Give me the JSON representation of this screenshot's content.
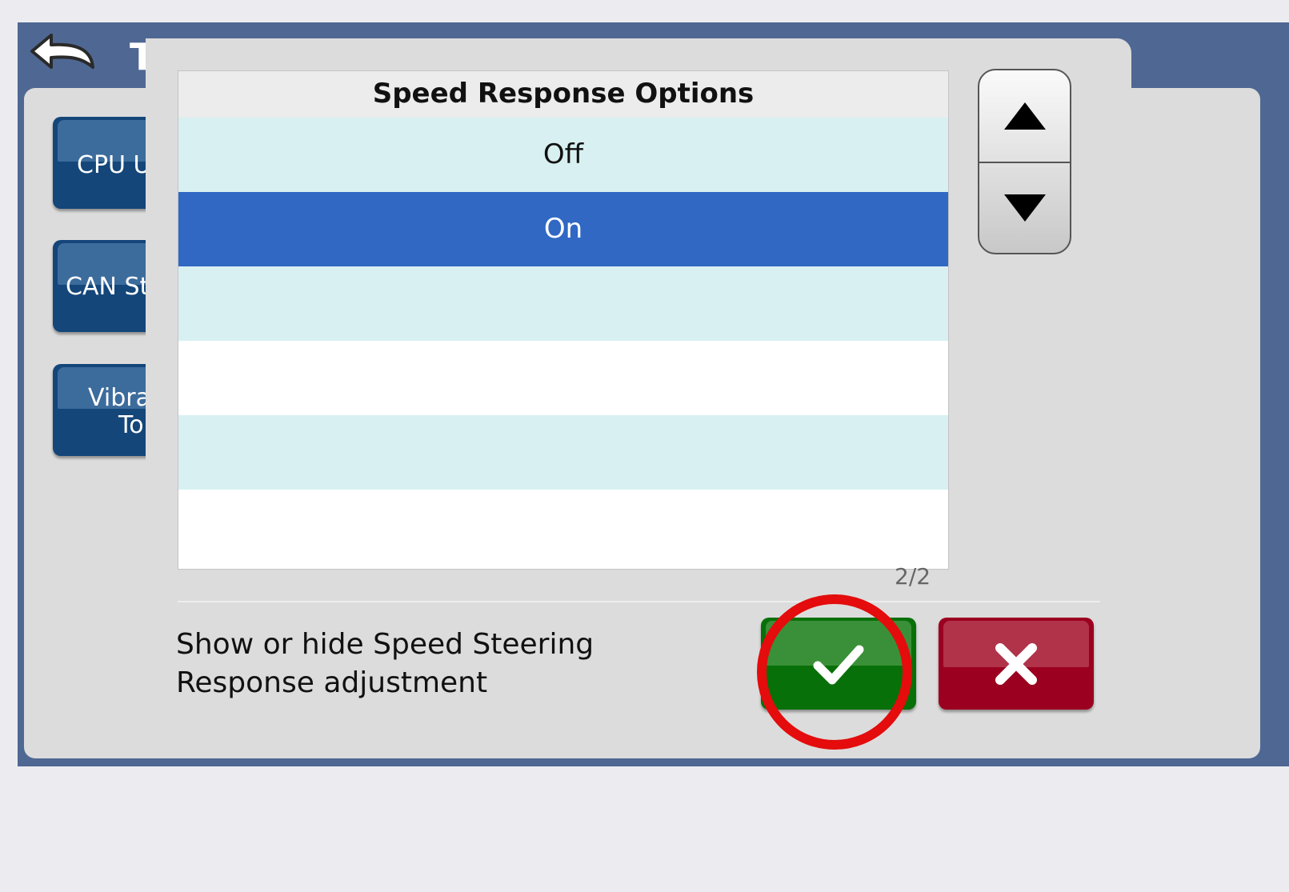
{
  "app": {
    "title": "T",
    "side_buttons": [
      {
        "label": "CPU U"
      },
      {
        "label": "CAN St"
      },
      {
        "label": "Vibra",
        "label2": "To"
      }
    ]
  },
  "dialog": {
    "title": "Speed Response Options",
    "options": [
      "Off",
      "On"
    ],
    "selected": "On",
    "page_indicator": "2/2",
    "description": "Show or hide Speed Steering Response adjustment",
    "buttons": {
      "scroll_up": "arrow-up-icon",
      "scroll_down": "arrow-down-icon",
      "confirm": "checkmark-icon",
      "cancel": "x-icon"
    }
  },
  "colors": {
    "app_frame": "#4f6893",
    "selected_row": "#3068c4",
    "alt_row": "#d8f0f1",
    "confirm": "#087008",
    "cancel": "#9c0020",
    "highlight": "#e40c0c"
  }
}
